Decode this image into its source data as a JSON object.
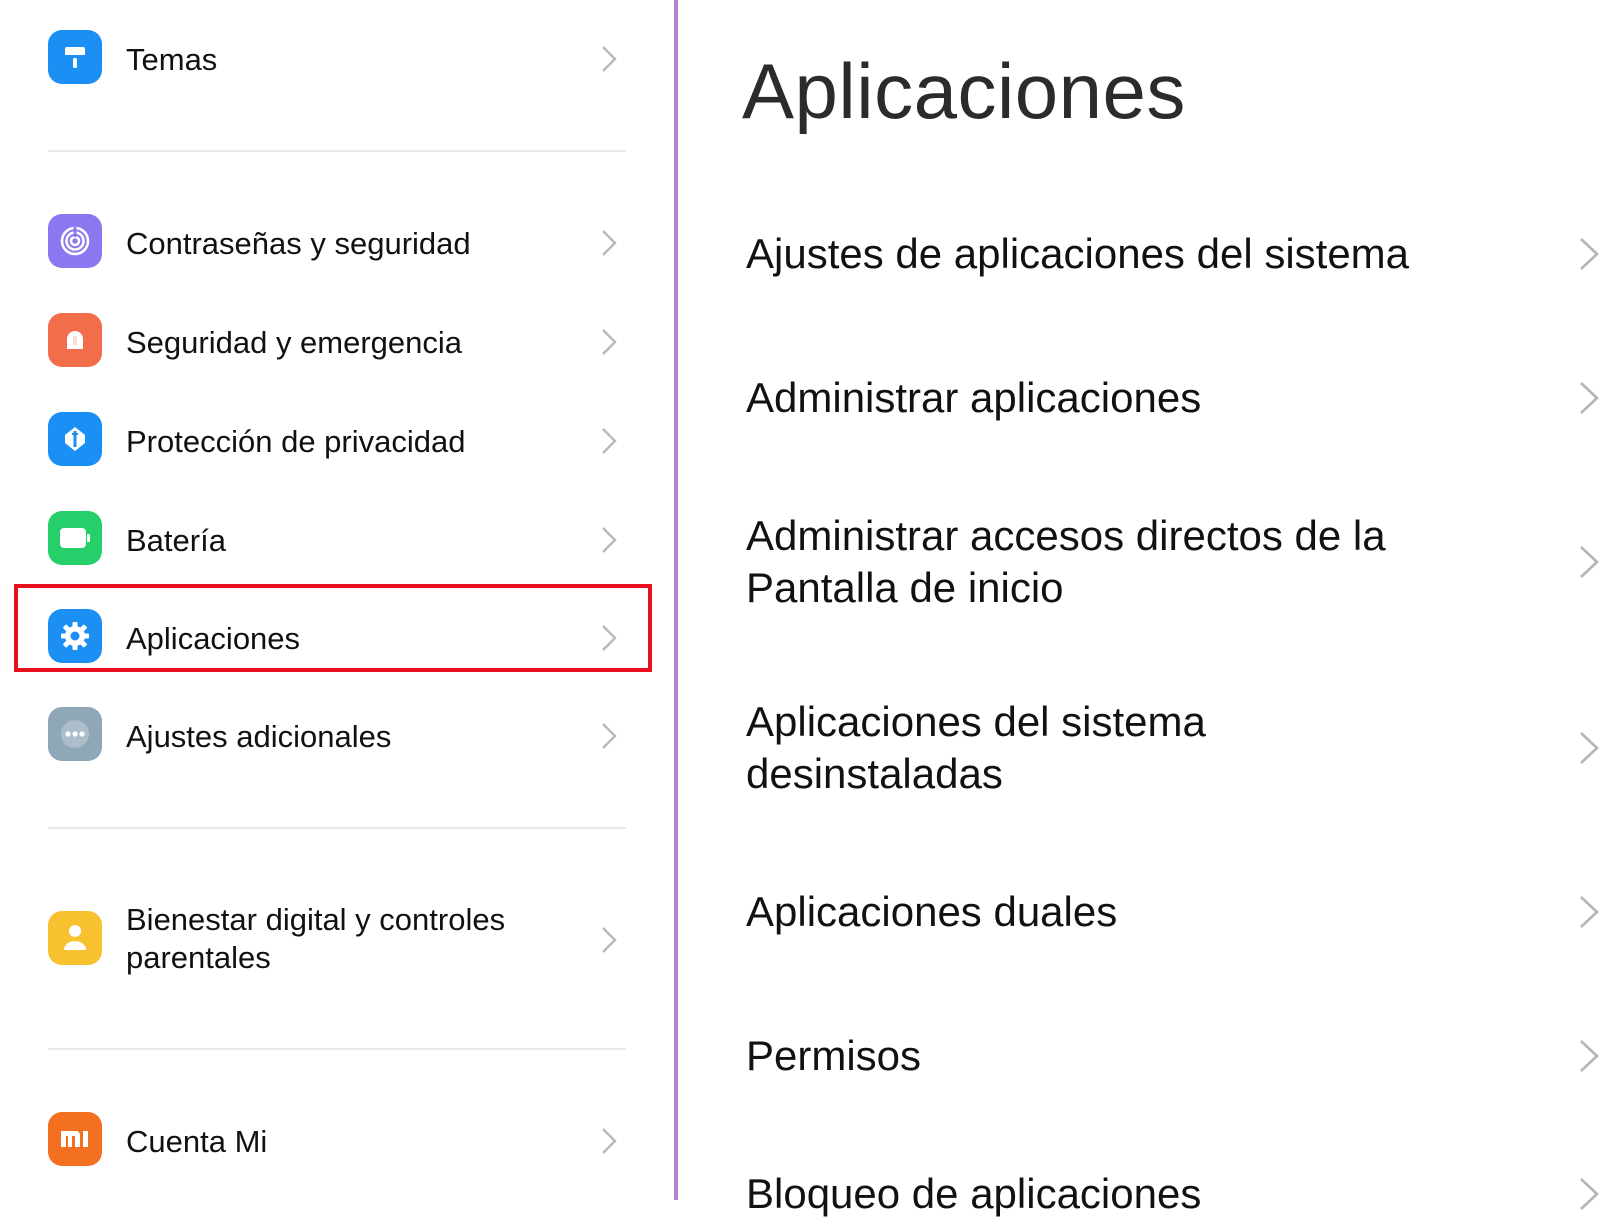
{
  "left_menu": {
    "items": [
      {
        "label": "Temas",
        "icon": "paint-roller-icon",
        "color": "#1c8ff5"
      },
      {
        "label": "Contraseñas y seguridad",
        "icon": "fingerprint-icon",
        "color": "#8a78f0"
      },
      {
        "label": "Seguridad y emergencia",
        "icon": "bell-icon",
        "color": "#f26e4a"
      },
      {
        "label": "Protección de privacidad",
        "icon": "privacy-icon",
        "color": "#1a8ff5"
      },
      {
        "label": "Batería",
        "icon": "battery-icon",
        "color": "#26cf6a"
      },
      {
        "label": "Aplicaciones",
        "icon": "gear-icon",
        "color": "#1c8ff5"
      },
      {
        "label": "Ajustes adicionales",
        "icon": "dots-icon",
        "color": "#8fa8b8"
      },
      {
        "label": "Bienestar digital y controles parentales",
        "icon": "family-icon",
        "color": "#f8c12f"
      },
      {
        "label": "Cuenta Mi",
        "icon": "mi-logo-icon",
        "color": "#f37021"
      }
    ]
  },
  "highlight_color": "#e8101e",
  "right_panel": {
    "title": "Aplicaciones",
    "items": [
      {
        "label": "Ajustes de aplicaciones del sistema"
      },
      {
        "label": "Administrar aplicaciones"
      },
      {
        "label": "Administrar accesos directos de la Pantalla de inicio"
      },
      {
        "label": "Aplicaciones del sistema desinstaladas"
      },
      {
        "label": "Aplicaciones duales"
      },
      {
        "label": "Permisos"
      },
      {
        "label": "Bloqueo de aplicaciones"
      }
    ]
  }
}
